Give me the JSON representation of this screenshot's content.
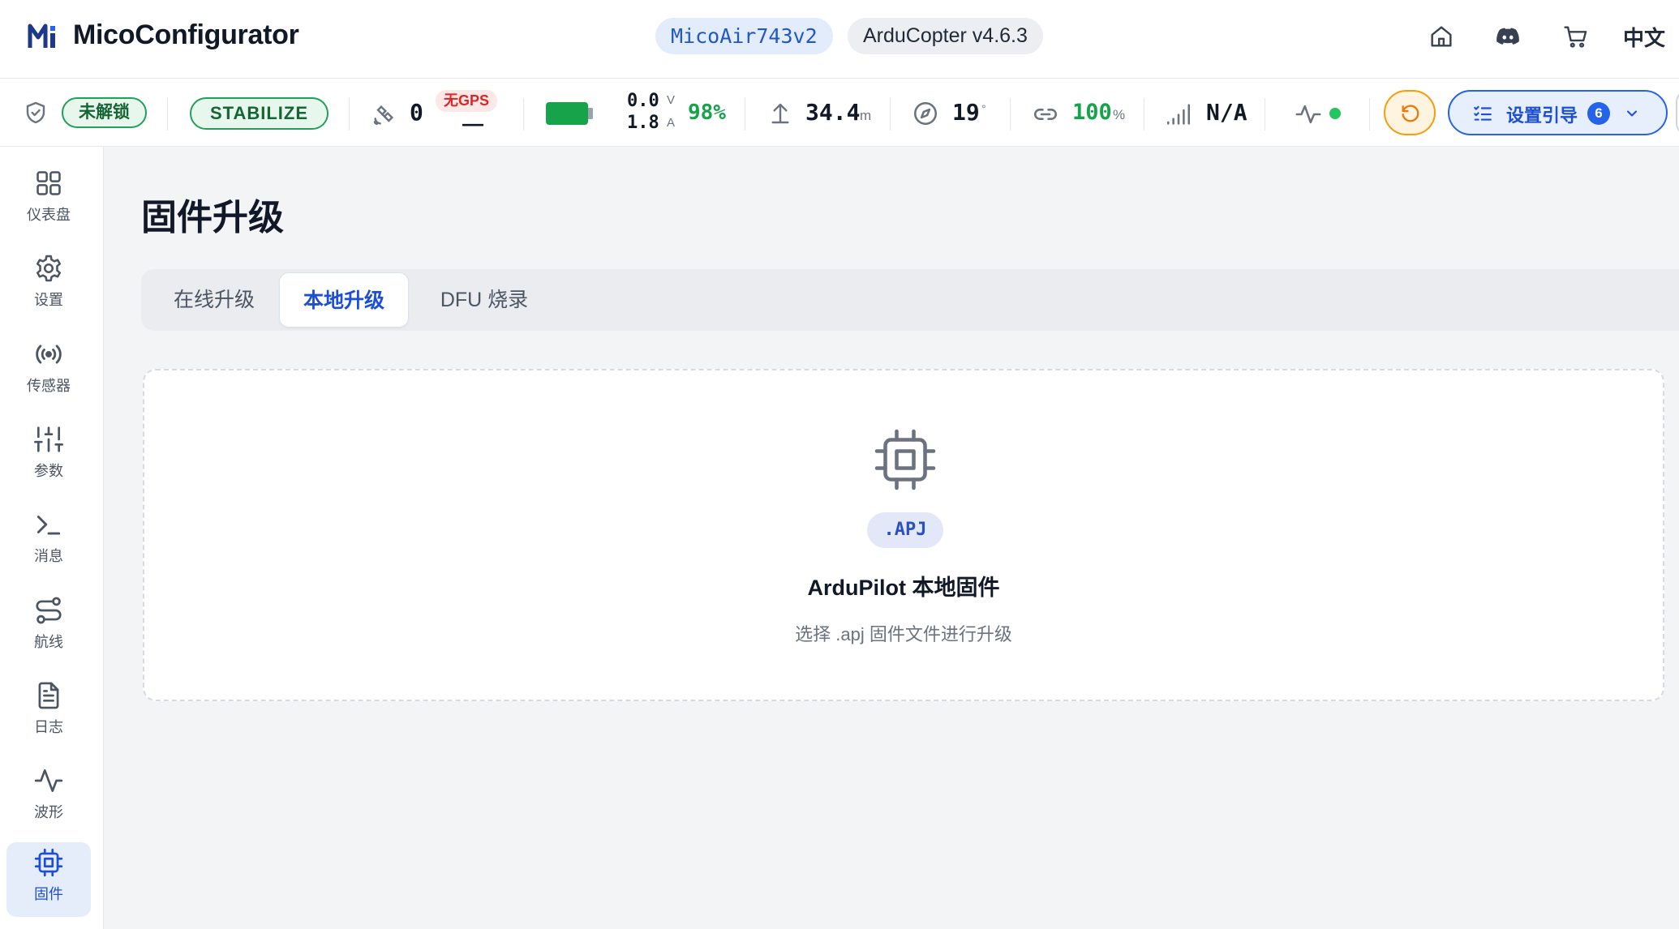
{
  "header": {
    "app_title": "MicoConfigurator",
    "board": "MicoAir743v2",
    "firmware": "ArduCopter v4.6.3",
    "language": "中文",
    "icons": [
      "home-icon",
      "discord-icon",
      "cart-icon"
    ]
  },
  "status": {
    "arm_state": "未解锁",
    "flight_mode": "STABILIZE",
    "satellites": "0",
    "gps_status": "无GPS",
    "gps_fix": "—",
    "voltage": "0.0",
    "voltage_unit": "V",
    "current": "1.8",
    "current_unit": "A",
    "battery_percent": "98%",
    "battery_level": 0.98,
    "altitude": "34.4",
    "altitude_unit": "m",
    "heading": "19",
    "heading_unit": "°",
    "link_quality": "100",
    "link_unit": "%",
    "rssi": "N/A",
    "guide_label": "设置引导",
    "guide_count": "6",
    "colors": {
      "ok": "#16a34a",
      "warn": "#f59e0b",
      "accent": "#2563eb",
      "error": "#dc2626"
    }
  },
  "sidebar": {
    "items": [
      {
        "label": "仪表盘",
        "icon": "dashboard-grid-icon"
      },
      {
        "label": "设置",
        "icon": "gear-icon"
      },
      {
        "label": "传感器",
        "icon": "broadcast-icon"
      },
      {
        "label": "参数",
        "icon": "sliders-icon"
      },
      {
        "label": "消息",
        "icon": "terminal-icon"
      },
      {
        "label": "航线",
        "icon": "route-icon"
      },
      {
        "label": "日志",
        "icon": "document-icon"
      },
      {
        "label": "波形",
        "icon": "waveform-icon"
      },
      {
        "label": "固件",
        "icon": "chip-icon"
      }
    ],
    "active": "固件"
  },
  "main": {
    "title": "固件升级",
    "tabs": [
      {
        "label": "在线升级"
      },
      {
        "label": "本地升级"
      },
      {
        "label": "DFU 烧录"
      }
    ],
    "active_tab": "本地升级",
    "dropzone": {
      "icon": "chip-icon",
      "extension": ".APJ",
      "title": "ArduPilot 本地固件",
      "hint": "选择 .apj 固件文件进行升级"
    }
  }
}
